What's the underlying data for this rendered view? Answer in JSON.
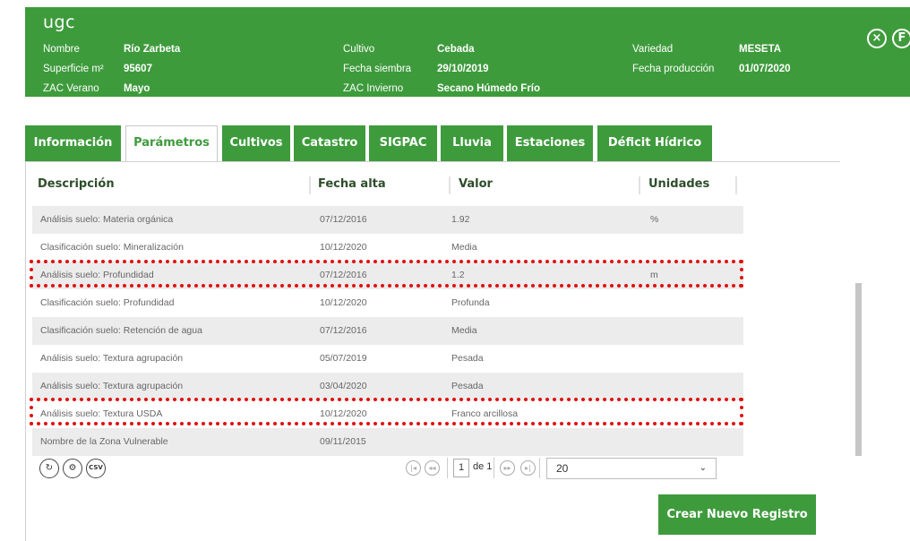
{
  "app": {
    "title": "ugc"
  },
  "header": {
    "fields": [
      {
        "label": "Nombre",
        "value": "Río Zarbeta"
      },
      {
        "label": "Superficie m²",
        "value": "95607"
      },
      {
        "label": "ZAC Verano",
        "value": "Mayo"
      },
      {
        "label": "Cultivo",
        "value": "Cebada"
      },
      {
        "label": "Fecha siembra",
        "value": "29/10/2019"
      },
      {
        "label": "ZAC Invierno",
        "value": "Secano Húmedo Frío"
      },
      {
        "label": "Variedad",
        "value": "MESETA"
      },
      {
        "label": "Fecha producción",
        "value": "01/07/2020"
      }
    ],
    "close_icon": "×",
    "save_icon": "F"
  },
  "tabs": [
    {
      "label": "Información",
      "active": false
    },
    {
      "label": "Parámetros",
      "active": true
    },
    {
      "label": "Cultivos",
      "active": false
    },
    {
      "label": "Catastro",
      "active": false
    },
    {
      "label": "SIGPAC",
      "active": false
    },
    {
      "label": "Lluvia",
      "active": false
    },
    {
      "label": "Estaciones",
      "active": false
    },
    {
      "label": "Déficit Hídrico",
      "active": false
    }
  ],
  "grid": {
    "columns": [
      "Descripción",
      "Fecha alta",
      "Valor",
      "Unidades"
    ],
    "rows": [
      {
        "descripcion": "Análisis suelo: Materia orgánica",
        "fecha": "07/12/2016",
        "valor": "1.92",
        "unidades": "%"
      },
      {
        "descripcion": "Clasificación suelo: Mineralización",
        "fecha": "10/12/2020",
        "valor": "Media",
        "unidades": ""
      },
      {
        "descripcion": "Análisis suelo: Profundidad",
        "fecha": "07/12/2016",
        "valor": "1.2",
        "unidades": "m"
      },
      {
        "descripcion": "Clasificación suelo: Profundidad",
        "fecha": "10/12/2020",
        "valor": "Profunda",
        "unidades": ""
      },
      {
        "descripcion": "Clasificación suelo: Retención de agua",
        "fecha": "07/12/2016",
        "valor": "Media",
        "unidades": ""
      },
      {
        "descripcion": "Análisis suelo: Textura agrupación",
        "fecha": "05/07/2019",
        "valor": "Pesada",
        "unidades": ""
      },
      {
        "descripcion": "Análisis suelo: Textura agrupación",
        "fecha": "03/04/2020",
        "valor": "Pesada",
        "unidades": ""
      },
      {
        "descripcion": "Análisis suelo: Textura USDA",
        "fecha": "10/12/2020",
        "valor": "Franco arcillosa",
        "unidades": ""
      },
      {
        "descripcion": "Nombre de la Zona Vulnerable",
        "fecha": "09/11/2015",
        "valor": "",
        "unidades": ""
      }
    ],
    "highlight_color": "#e01010"
  },
  "toolbar": {
    "refresh_icon": "refresh-icon",
    "settings_icon": "gear-icon",
    "csv_label": "CSV"
  },
  "pager": {
    "current_page": "1",
    "of_label": "de 1",
    "page_size": "20"
  },
  "actions": {
    "create_label": "Crear Nuevo Registro"
  },
  "colors": {
    "brand_green": "#3e9b3c",
    "header_text": "#2d4d2a",
    "row_alt": "#ececec"
  }
}
